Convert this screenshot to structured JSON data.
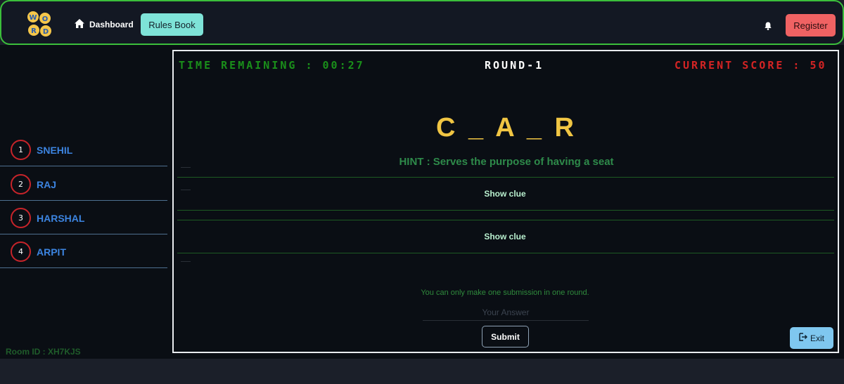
{
  "nav": {
    "logo_letters": [
      "W",
      "O",
      "R",
      "D"
    ],
    "dashboard_label": "Dashboard",
    "rules_label": "Rules Book",
    "register_label": "Register"
  },
  "sidebar": {
    "players": [
      {
        "rank": "1",
        "name": "SNEHIL"
      },
      {
        "rank": "2",
        "name": "RAJ"
      },
      {
        "rank": "3",
        "name": "HARSHAL"
      },
      {
        "rank": "4",
        "name": "ARPIT"
      }
    ],
    "room_id": "Room ID : XH7KJS"
  },
  "game": {
    "timer": "TIME REMAINING : 00:27",
    "round": "ROUND-1",
    "score": "CURRENT SCORE : 50",
    "word": "C _ A _ R",
    "hint": "HINT : Serves the purpose of having a seat",
    "clues": [
      "Show clue",
      "Show clue"
    ],
    "note": "You can only make one submission in one round.",
    "answer_placeholder": "Your Answer",
    "answer_value": "",
    "submit_label": "Submit",
    "exit_label": "Exit"
  },
  "colors": {
    "nav_border": "#3bbf3b",
    "rules_button": "#7ee3d8",
    "register_button": "#f06263",
    "timer": "#1a8f1a",
    "score": "#d42424",
    "word": "#f0c543",
    "hint": "#2e8a4a",
    "player_name": "#3c84e0",
    "exit_button": "#7fc7ef"
  },
  "icons": {
    "dashboard": "home-icon",
    "notifications": "bell-icon",
    "exit": "exit-icon"
  }
}
